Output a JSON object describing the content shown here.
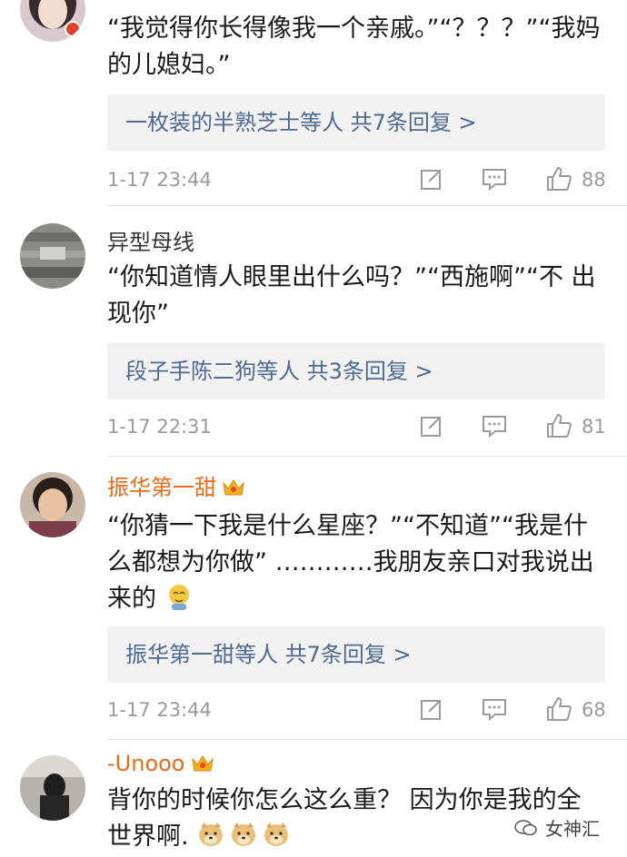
{
  "comments": [
    {
      "username": "",
      "text": "“我觉得你长得像我一个亲戚。”“？？？”“我妈的儿媳妇。”",
      "reply_summary": "一枚装的半熟芝士等人 共7条回复 >",
      "time": "1-17 23:44",
      "likes": "88"
    },
    {
      "username": "异型母线",
      "text": "“你知道情人眼里出什么吗？”“西施啊”“不 出现你”",
      "reply_summary": "段子手陈二狗等人 共3条回复 >",
      "time": "1-17 22:31",
      "likes": "81"
    },
    {
      "username": "振华第一甜",
      "text": "“你猜一下我是什么星座？”“不知道”“我是什么都想为你做” …………我朋友亲口对我说出来的",
      "reply_summary": "振华第一甜等人 共7条回复 >",
      "time": "1-17 23:44",
      "likes": "68"
    },
    {
      "username": "-Unooo",
      "text": "背你的时候你怎么这么重？ 因为你是我的全世界啊."
    }
  ],
  "icons": {
    "share": "share-icon",
    "reply": "comment-icon",
    "like": "thumbs-up-icon",
    "crown": "crown-badge-icon",
    "emoji_cry": "crying-emoji-icon",
    "emoji_doge": "doge-emoji-icon"
  },
  "watermark": {
    "label": "女神汇"
  },
  "colors": {
    "link": "#4e6a92",
    "username_vip": "#e86b1a",
    "meta": "#9a9a9a",
    "reply_bg": "#f2f2f2"
  }
}
